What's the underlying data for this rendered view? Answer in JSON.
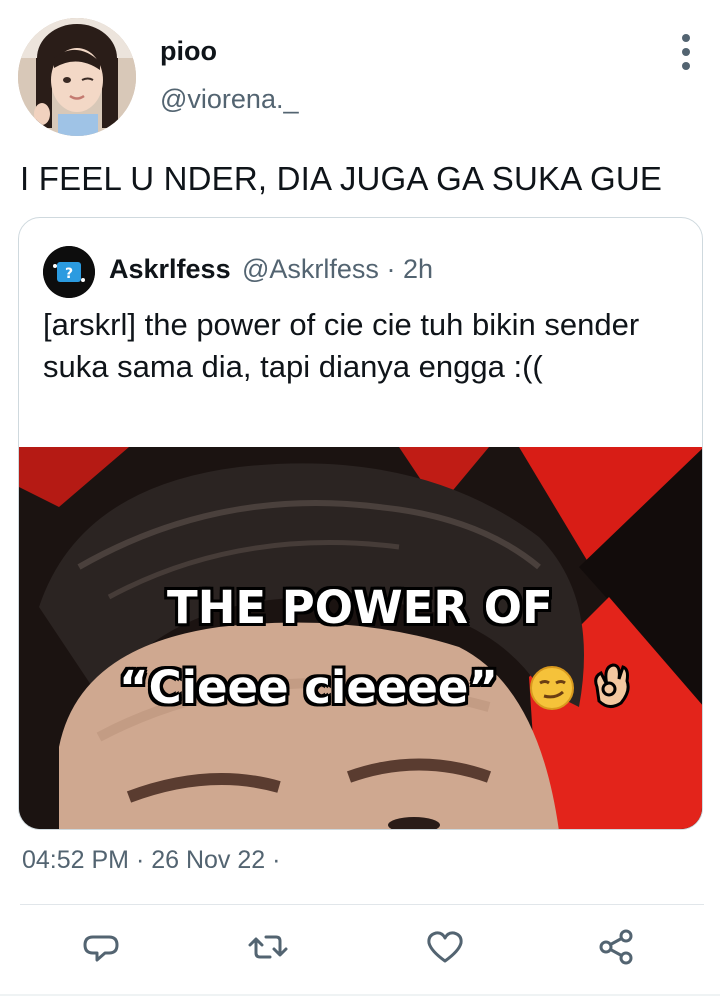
{
  "tweet": {
    "author": {
      "display_name": "pioo",
      "handle": "@viorena._"
    },
    "text": "I FEEL U NDER, DIA JUGA GA SUKA GUE",
    "timestamp": "04:52 PM · 26 Nov 22 ·",
    "more_icon": "more-vertical-icon"
  },
  "quote": {
    "author": {
      "display_name": "Askrlfess",
      "handle": "@Askrlfess",
      "time": "· 2h"
    },
    "text": "[arskrl] the power of cie cie tuh bikin sender suka sama dia, tapi dianya engga :((",
    "media": {
      "caption_line1": "THE POWER OF",
      "caption_line2": "“Cieee cieeee”",
      "emojis": [
        "smirking-face",
        "ok-hand"
      ]
    }
  },
  "actions": [
    {
      "icon": "reply-icon"
    },
    {
      "icon": "retweet-icon"
    },
    {
      "icon": "like-icon"
    },
    {
      "icon": "share-icon"
    }
  ],
  "colors": {
    "text_primary": "#0f1419",
    "text_secondary": "#536471",
    "border": "#cfd9de",
    "media_red": "#e0221a"
  }
}
